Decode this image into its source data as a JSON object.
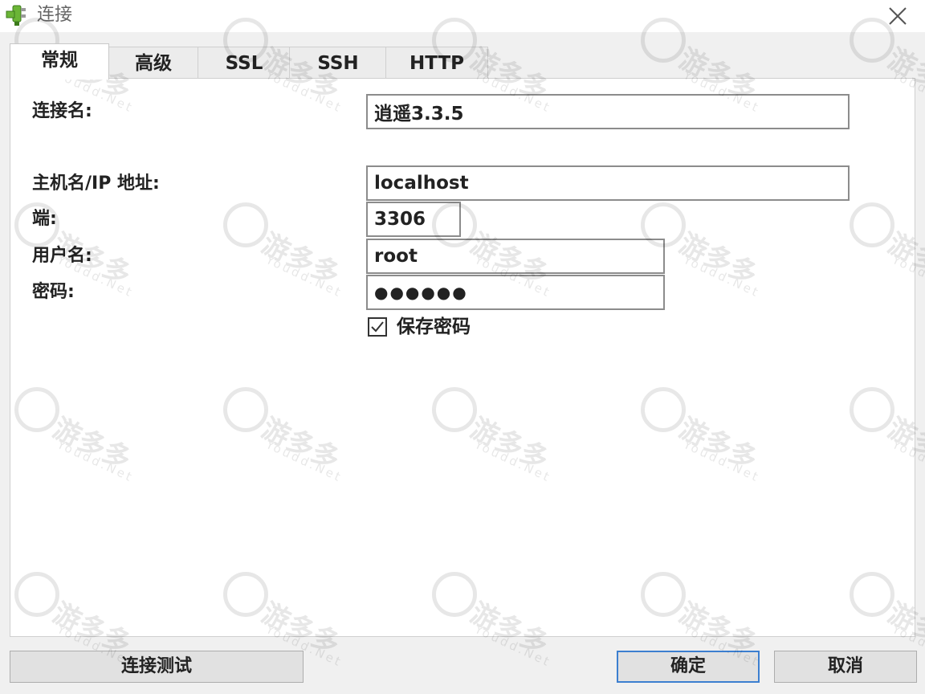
{
  "window": {
    "title": "连接",
    "icon": "connection-plug-icon",
    "close_icon": "close-icon"
  },
  "tabs": [
    {
      "label": "常规",
      "active": true
    },
    {
      "label": "高级",
      "active": false
    },
    {
      "label": "SSL",
      "active": false
    },
    {
      "label": "SSH",
      "active": false
    },
    {
      "label": "HTTP",
      "active": false
    }
  ],
  "form": {
    "connection_name_label": "连接名:",
    "connection_name_value": "逍遥3.3.5",
    "host_label": "主机名/IP 地址:",
    "host_value": "localhost",
    "port_label": "端:",
    "port_value": "3306",
    "user_label": "用户名:",
    "user_value": "root",
    "password_label": "密码:",
    "password_value": "●●●●●●",
    "save_password_label": "保存密码",
    "save_password_checked": true
  },
  "buttons": {
    "test": "连接测试",
    "ok": "确定",
    "cancel": "取消"
  },
  "watermark": {
    "text": "游多多",
    "sub": "Youdd.Net"
  },
  "colors": {
    "accent_border": "#3c7fd0",
    "icon_green": "#6bb536"
  }
}
